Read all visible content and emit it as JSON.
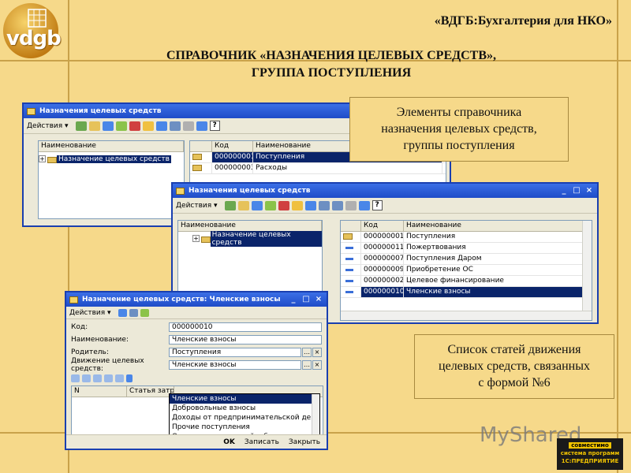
{
  "slide": {
    "logo_text": "vdgb",
    "brand": "«ВДГБ:Бухгалтерия для НКО»",
    "title_line1": "СПРАВОЧНИК «НАЗНАЧЕНИЯ ЦЕЛЕВЫХ СРЕДСТВ»,",
    "title_line2": "ГРУППА ПОСТУПЛЕНИЯ",
    "callout_top": [
      "Элементы справочника",
      "назначения целевых средств,",
      "группы поступления"
    ],
    "callout_bottom": [
      "Список статей движения",
      "целевых средств, связанных",
      "с формой №6"
    ],
    "watermark": "MyShared",
    "onec_badge": [
      "совместимо",
      "система программ",
      "1С:ПРЕДПРИЯТИЕ"
    ]
  },
  "win1": {
    "title": "Назначения целевых средств",
    "actions": "Действия ▾",
    "tree_header": "Наименование",
    "tree_item": "Назначение целевых средств",
    "columns": [
      "Код",
      "Наименование"
    ],
    "rows": [
      {
        "code": "000000001",
        "name": "Поступления"
      },
      {
        "code": "000000003",
        "name": "Расходы"
      }
    ]
  },
  "win2": {
    "title": "Назначения целевых средств",
    "actions": "Действия ▾",
    "tree_header": "Наименование",
    "tree_item": "Назначение целевых средств",
    "columns": [
      "Код",
      "Наименование"
    ],
    "rows": [
      {
        "code": "000000001",
        "name": "Поступления"
      },
      {
        "code": "000000011",
        "name": "Пожертвования"
      },
      {
        "code": "000000007",
        "name": "Поступления Даром"
      },
      {
        "code": "000000009",
        "name": "Приобретение ОС"
      },
      {
        "code": "000000002",
        "name": "Целевое финансирование"
      },
      {
        "code": "000000010",
        "name": "Членские взносы"
      }
    ]
  },
  "win3": {
    "title": "Назначение целевых средств: Членские взносы",
    "actions": "Действия ▾",
    "fields": [
      {
        "label": "Код:",
        "value": "000000010"
      },
      {
        "label": "Наименование:",
        "value": "Членские взносы"
      },
      {
        "label": "Родитель:",
        "value": "Поступления"
      },
      {
        "label": "Движение целевых средств:",
        "value": "Членские взносы"
      }
    ],
    "dropdown": [
      "Членские взносы",
      "Добровольные взносы",
      "Доходы от предпринимательской деяте...",
      "Прочие поступления",
      "Оказание социальной и благотворител..."
    ],
    "table_columns": [
      "N",
      "Статья затра"
    ],
    "buttons": {
      "ok": "OK",
      "save": "Записать",
      "close": "Закрыть"
    }
  }
}
